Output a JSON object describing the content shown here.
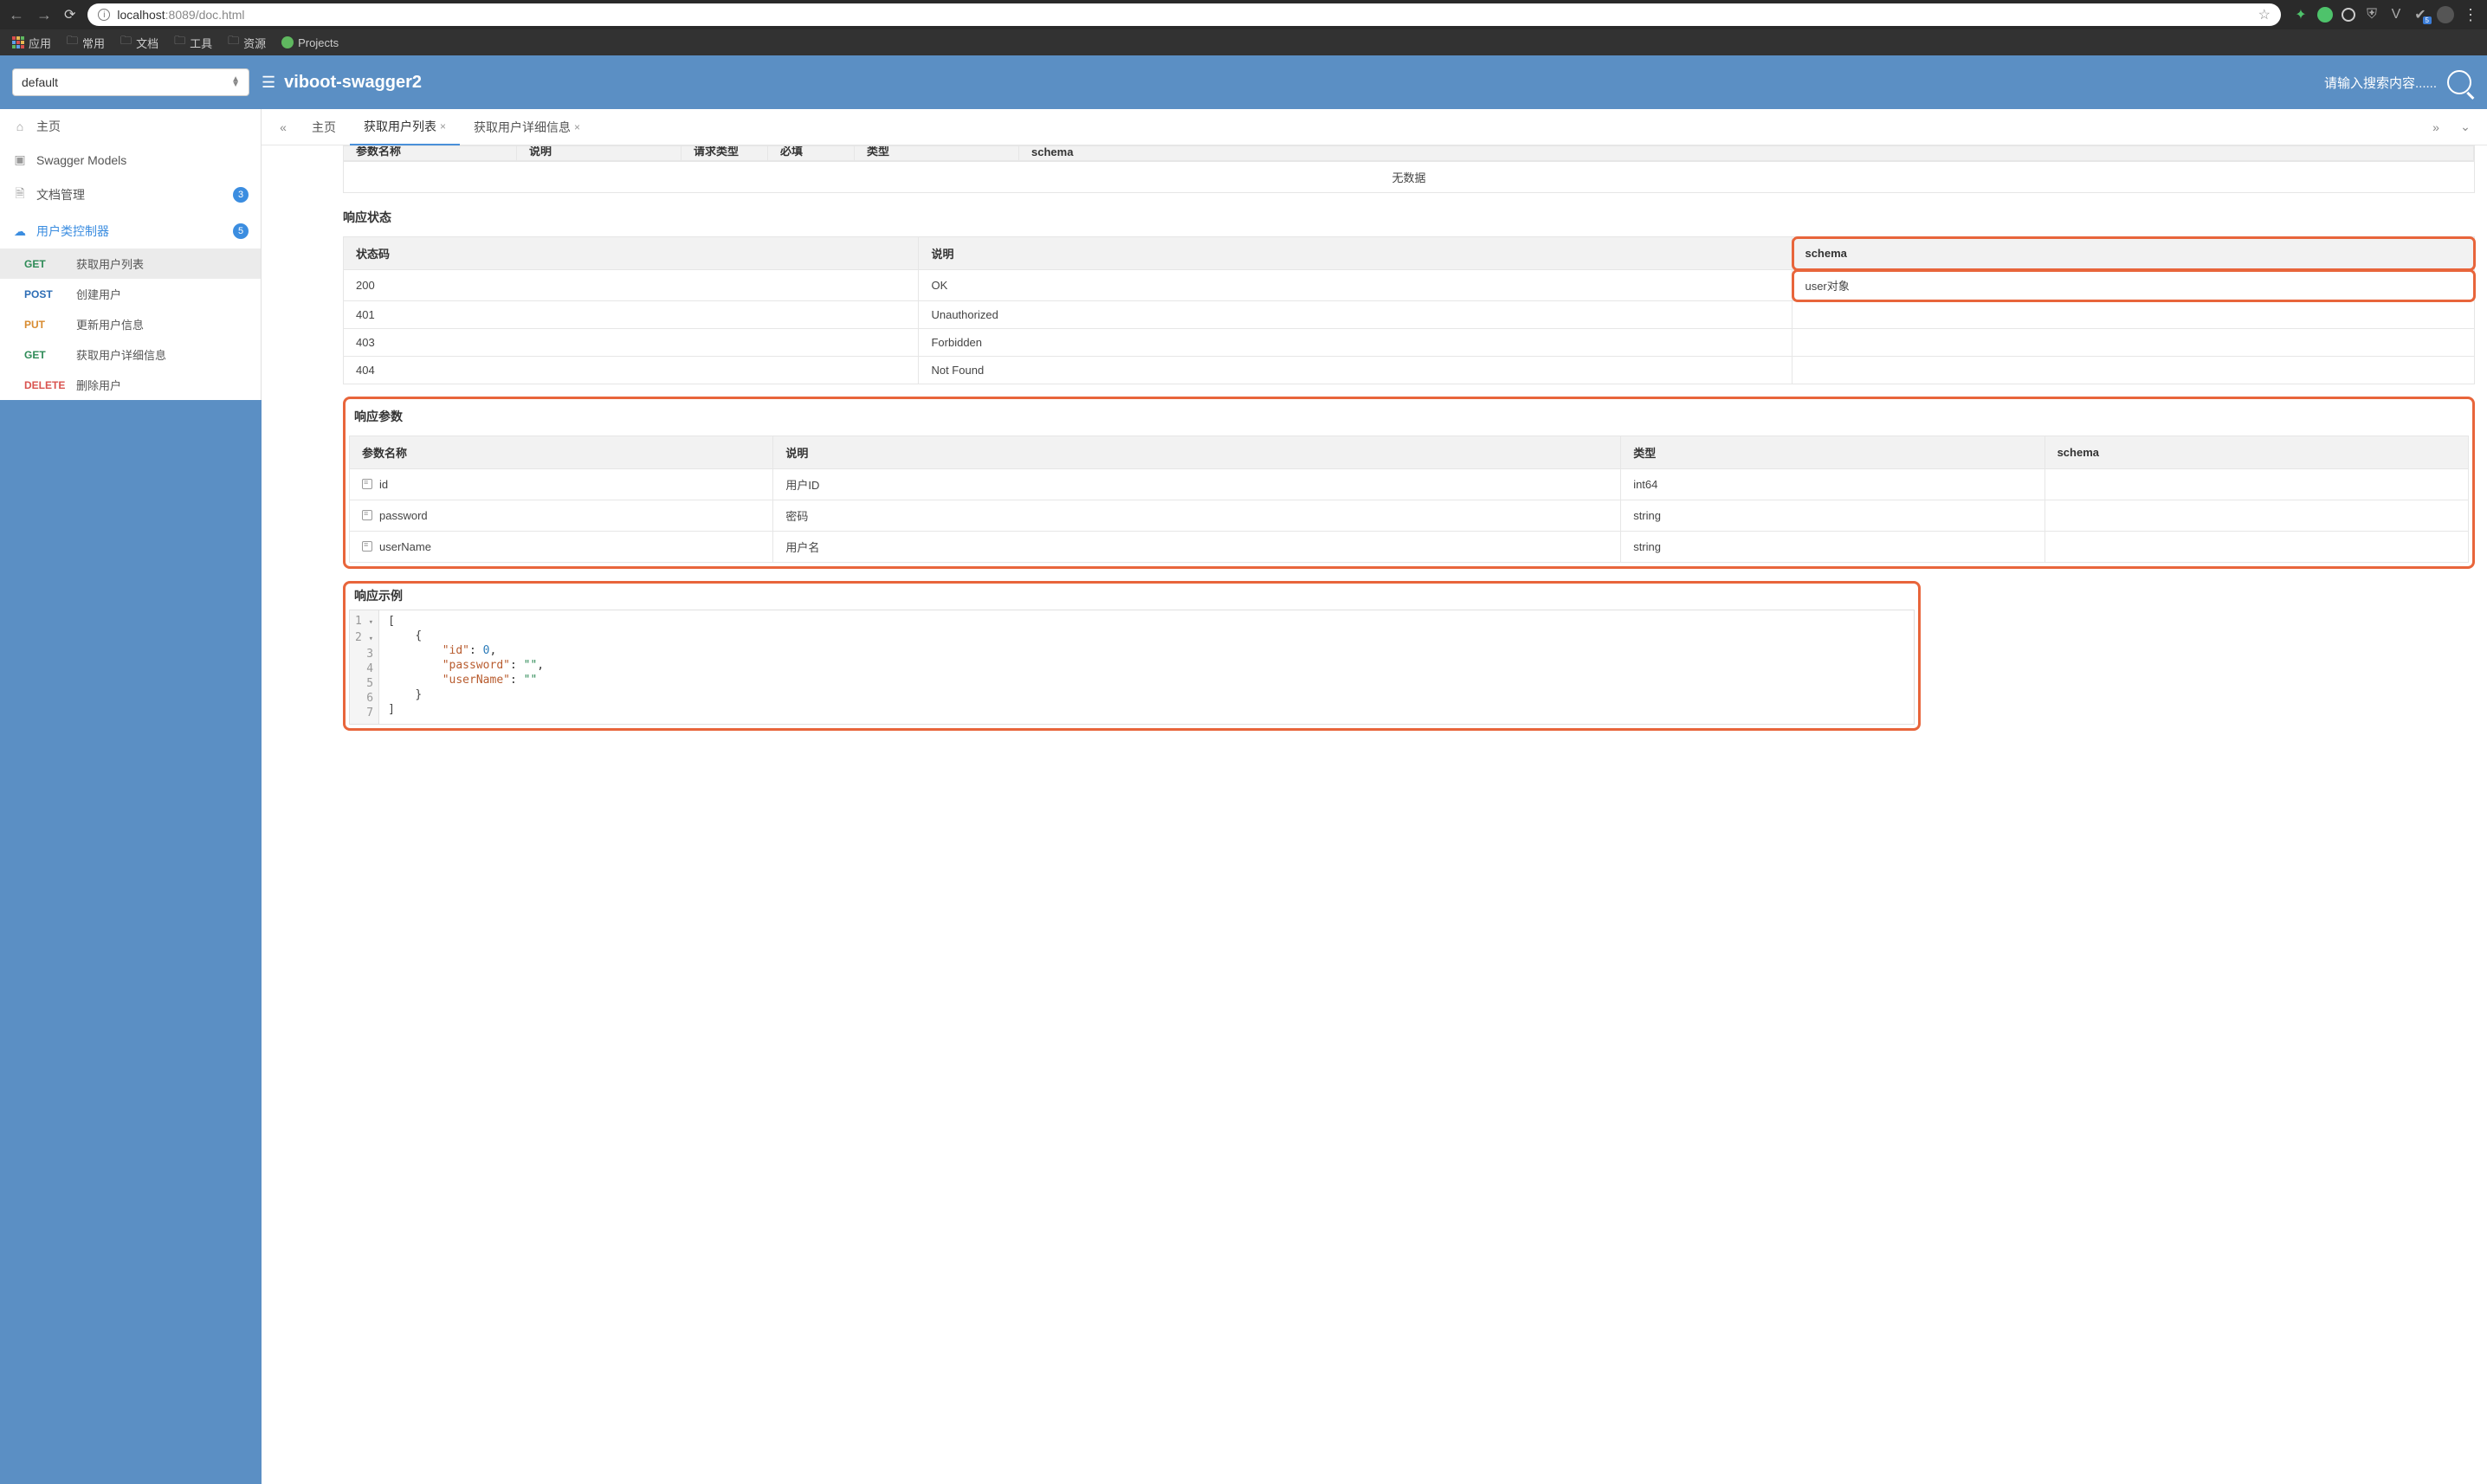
{
  "browser": {
    "url_host": "localhost",
    "url_port": ":8089",
    "url_path": "/doc.html"
  },
  "bookmarks": {
    "apps": "应用",
    "folders": [
      "常用",
      "文档",
      "工具",
      "资源"
    ],
    "projects": "Projects"
  },
  "header": {
    "group_selected": "default",
    "app_title": "viboot-swagger2",
    "search_placeholder": "请输入搜索内容......"
  },
  "sidebar": {
    "home": "主页",
    "swagger_models": "Swagger Models",
    "doc_mgmt": {
      "label": "文档管理",
      "count": "3"
    },
    "user_ctrl": {
      "label": "用户类控制器",
      "count": "5"
    },
    "apis": [
      {
        "method": "GET",
        "m_class": "m-get",
        "label": "获取用户列表"
      },
      {
        "method": "POST",
        "m_class": "m-post",
        "label": "创建用户"
      },
      {
        "method": "PUT",
        "m_class": "m-put",
        "label": "更新用户信息"
      },
      {
        "method": "GET",
        "m_class": "m-get",
        "label": "获取用户详细信息"
      },
      {
        "method": "DELETE",
        "m_class": "m-delete",
        "label": "删除用户"
      }
    ]
  },
  "tabs": {
    "home": "主页",
    "t1": "获取用户列表",
    "t2": "获取用户详细信息"
  },
  "partial_headers": {
    "c1": "参数名称",
    "c2": "说明",
    "c3": "请求类型",
    "c4": "必填",
    "c5": "类型",
    "c6": "schema"
  },
  "no_data": "无数据",
  "resp_status": {
    "title": "响应状态",
    "cols": {
      "code": "状态码",
      "desc": "说明",
      "schema": "schema"
    },
    "rows": [
      {
        "code": "200",
        "desc": "OK",
        "schema": "user对象"
      },
      {
        "code": "401",
        "desc": "Unauthorized",
        "schema": ""
      },
      {
        "code": "403",
        "desc": "Forbidden",
        "schema": ""
      },
      {
        "code": "404",
        "desc": "Not Found",
        "schema": ""
      }
    ]
  },
  "resp_params": {
    "title": "响应参数",
    "cols": {
      "name": "参数名称",
      "desc": "说明",
      "type": "类型",
      "schema": "schema"
    },
    "rows": [
      {
        "name": "id",
        "desc": "用户ID",
        "type": "int64",
        "schema": ""
      },
      {
        "name": "password",
        "desc": "密码",
        "type": "string",
        "schema": ""
      },
      {
        "name": "userName",
        "desc": "用户名",
        "type": "string",
        "schema": ""
      }
    ]
  },
  "resp_example": {
    "title": "响应示例",
    "lines": [
      "[",
      "    {",
      "        \"id\": 0,",
      "        \"password\": \"\",",
      "        \"userName\": \"\"",
      "    }",
      "]"
    ]
  }
}
